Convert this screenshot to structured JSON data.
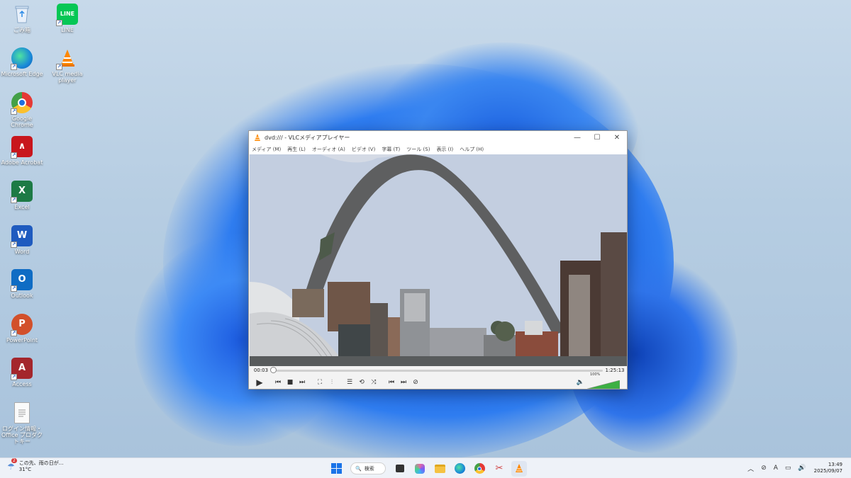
{
  "desktop": {
    "icons": [
      {
        "label": "ごみ箱",
        "icon": "recycle-bin-icon"
      },
      {
        "label": "Microsoft Edge",
        "icon": "edge-icon"
      },
      {
        "label": "Google Chrome",
        "icon": "chrome-icon"
      },
      {
        "label": "Adobe Acrobat",
        "icon": "acrobat-icon"
      },
      {
        "label": "Excel",
        "icon": "excel-icon"
      },
      {
        "label": "Word",
        "icon": "word-icon"
      },
      {
        "label": "Outlook",
        "icon": "outlook-icon"
      },
      {
        "label": "PowerPoint",
        "icon": "powerpoint-icon"
      },
      {
        "label": "Access",
        "icon": "access-icon"
      },
      {
        "label": "ログイン情報・Office プロダクトキー",
        "icon": "text-file-icon"
      },
      {
        "label": "LINE",
        "icon": "line-icon"
      },
      {
        "label": "VLC media player",
        "icon": "vlc-icon"
      }
    ]
  },
  "vlc": {
    "title": "dvd:/// - VLCメディアプレイヤー",
    "menu": [
      "メディア (M)",
      "再生 (L)",
      "オーディオ (A)",
      "ビデオ (V)",
      "字幕 (T)",
      "ツール (S)",
      "表示 (I)",
      "ヘルプ (H)"
    ],
    "elapsed": "00:03",
    "duration": "1:25:13",
    "progress": 0.0006,
    "volume": "100%",
    "volume_level": 1.0,
    "accent": "#ff8800"
  },
  "taskbar": {
    "weather_badge": "2",
    "weather_text": "この先、雨の日が...",
    "temperature": "31°C",
    "search_label": "検索",
    "time": "13:49",
    "date": "2025/09/07",
    "ime": "A"
  }
}
